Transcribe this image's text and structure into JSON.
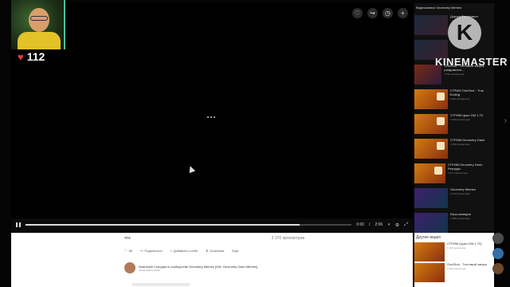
{
  "stream": {
    "heart_count": "112"
  },
  "overlay": {
    "brand_text": "KINEMASTER",
    "logo_glyph": "K"
  },
  "player": {
    "time_current": "0:00",
    "time_total": "2:06",
    "progress": 0.84
  },
  "sidebar": {
    "title": "Видеозаписи Geometry Memes",
    "items": [
      {
        "title": "Дорога без правил",
        "sub": ""
      },
      {
        "title": "",
        "sub": ""
      },
      {
        "title": "OneShot · Тестовый запуск рандомного...",
        "sub": "3 739 просмотров"
      },
      {
        "title": "СТРИМ OneShot · True Ending",
        "sub": "2 620 просмотров"
      },
      {
        "title": "СТРИМ Цикл GM 1.70",
        "sub": "2 420 просмотров"
      },
      {
        "title": "СТРИМ Geometry Dash",
        "sub": "2 156 просмотров"
      },
      {
        "title": "СТРИМ Geometry Dash · Рекорды",
        "sub": "1 971 просмотров"
      },
      {
        "title": "Geometry Memes",
        "sub": "1 610 просмотров"
      },
      {
        "title": "Игра-комедия",
        "sub": "1 488 просмотров"
      }
    ]
  },
  "video": {
    "title": "что",
    "views": "2 370 просмотров",
    "actions": [
      {
        "label": "80",
        "icon": "heart-icon"
      },
      {
        "label": "Поделиться",
        "icon": "share-icon"
      },
      {
        "label": "Добавить к себе",
        "icon": "plus-icon"
      },
      {
        "label": "Download",
        "icon": "download-icon"
      },
      {
        "label": "Ещё",
        "icon": "more-icon"
      }
    ],
    "author_text": "Анатолий Солодин в сообществе Geometry Memes [GM, Geometry Dash Memes]",
    "date": "28 авг 2020 в 13:06"
  },
  "other_videos": {
    "title": "Другие видео",
    "items": [
      {
        "title": "СТРИМ (Цикл GM 1.70)",
        "sub": "1 164 просмотра"
      },
      {
        "title": "OneShot · Тестовый запуск",
        "sub": "3 392 просмотра"
      }
    ]
  }
}
